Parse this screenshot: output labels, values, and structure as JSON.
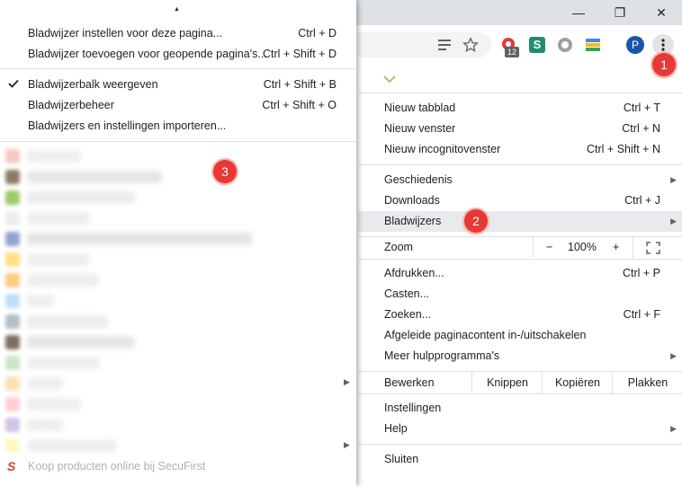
{
  "window": {
    "minimize_glyph": "—",
    "restore_glyph": "❐",
    "close_glyph": "✕"
  },
  "toolbar": {
    "extension_badge": "12",
    "profile_initial": "P",
    "extension_s_letter": "S"
  },
  "chrome_menu": {
    "new_tab": {
      "label": "Nieuw tabblad",
      "shortcut": "Ctrl + T"
    },
    "new_window": {
      "label": "Nieuw venster",
      "shortcut": "Ctrl + N"
    },
    "new_incognito": {
      "label": "Nieuw incognitovenster",
      "shortcut": "Ctrl + Shift + N"
    },
    "history": {
      "label": "Geschiedenis"
    },
    "downloads": {
      "label": "Downloads",
      "shortcut": "Ctrl + J"
    },
    "bookmarks": {
      "label": "Bladwijzers"
    },
    "zoom": {
      "label": "Zoom",
      "minus": "−",
      "value": "100%",
      "plus": "+"
    },
    "print": {
      "label": "Afdrukken...",
      "shortcut": "Ctrl + P"
    },
    "cast": {
      "label": "Casten..."
    },
    "find": {
      "label": "Zoeken...",
      "shortcut": "Ctrl + F"
    },
    "reader_mode": {
      "label": "Afgeleide paginacontent in-/uitschakelen"
    },
    "more_tools": {
      "label": "Meer hulpprogramma's"
    },
    "edit": {
      "label": "Bewerken",
      "cut": "Knippen",
      "copy": "Kopiëren",
      "paste": "Plakken"
    },
    "settings": {
      "label": "Instellingen"
    },
    "help": {
      "label": "Help"
    },
    "exit": {
      "label": "Sluiten"
    }
  },
  "bookmarks_menu": {
    "scroll_up_glyph": "▲",
    "bookmark_page": {
      "label": "Bladwijzer instellen voor deze pagina...",
      "shortcut": "Ctrl + D"
    },
    "bookmark_all": {
      "label": "Bladwijzer toevoegen voor geopende pagina's...",
      "shortcut": "Ctrl + Shift + D"
    },
    "show_bar": {
      "label": "Bladwijzerbalk weergeven",
      "shortcut": "Ctrl + Shift + B",
      "checked": true
    },
    "manager": {
      "label": "Bladwijzerbeheer",
      "shortcut": "Ctrl + Shift + O"
    },
    "import": {
      "label": "Bladwijzers en instellingen importeren..."
    },
    "last_bookmark": {
      "label": "Koop producten online bij SecuFirst"
    }
  },
  "annotations": {
    "one": "1",
    "two": "2",
    "three": "3"
  },
  "colors": {
    "badge": "#e53935",
    "highlight": "#e8eaed",
    "profile": "#1a56a8"
  }
}
